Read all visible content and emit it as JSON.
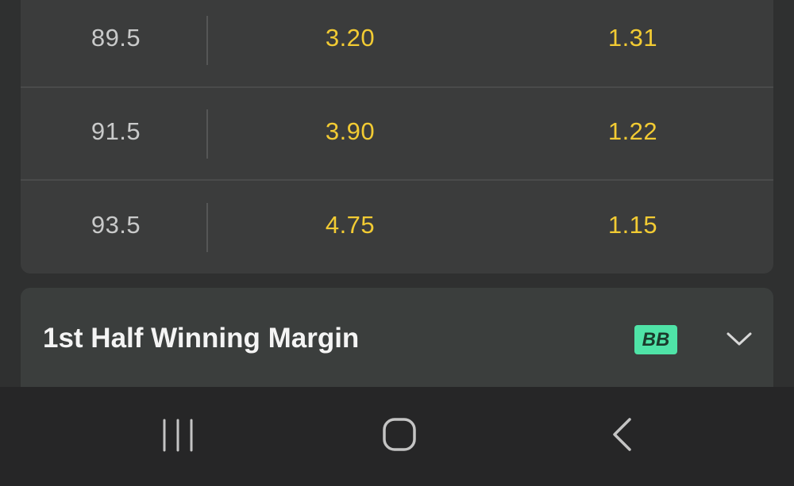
{
  "odds_table": {
    "rows": [
      {
        "line": "89.5",
        "over": "3.20",
        "under": "1.31"
      },
      {
        "line": "91.5",
        "over": "3.90",
        "under": "1.22"
      },
      {
        "line": "93.5",
        "over": "4.75",
        "under": "1.15"
      }
    ]
  },
  "market": {
    "title": "1st Half Winning Margin",
    "badge": "BB",
    "chevron_icon": "chevron-down-icon"
  },
  "navigation": {
    "recent_icon": "recent-apps-icon",
    "home_icon": "home-icon",
    "back_icon": "back-icon"
  },
  "colors": {
    "price": "#f2cb33",
    "badge": "#4fe3a7",
    "background": "#2f3030"
  }
}
